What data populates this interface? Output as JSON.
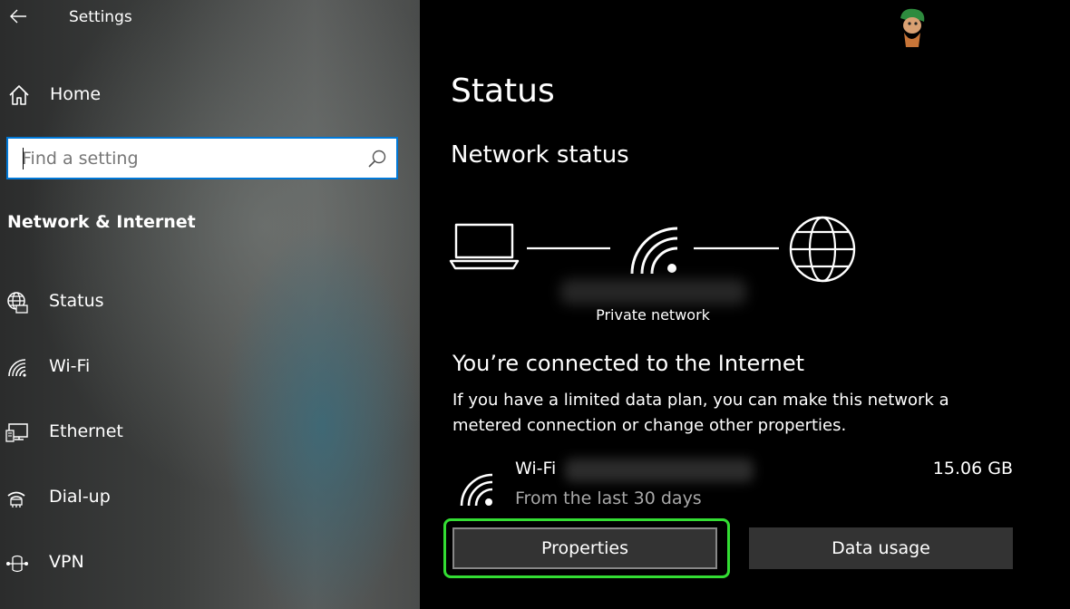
{
  "window": {
    "title": "Settings"
  },
  "sidebar": {
    "home_label": "Home",
    "search_placeholder": "Find a setting",
    "section_heading": "Network & Internet",
    "items": [
      {
        "label": "Status",
        "icon": "globe-status-icon"
      },
      {
        "label": "Wi-Fi",
        "icon": "wifi-icon"
      },
      {
        "label": "Ethernet",
        "icon": "ethernet-icon"
      },
      {
        "label": "Dial-up",
        "icon": "dial-up-icon"
      },
      {
        "label": "VPN",
        "icon": "vpn-icon"
      }
    ]
  },
  "main": {
    "title": "Status",
    "network_status_heading": "Network status",
    "network_type": "Private network",
    "connected_title": "You’re connected to the Internet",
    "connected_desc": "If you have a limited data plan, you can make this network a metered connection or change other properties.",
    "connection": {
      "name": "Wi-Fi",
      "period": "From the last 30 days",
      "usage": "15.06 GB"
    },
    "buttons": {
      "properties": "Properties",
      "data_usage": "Data usage"
    }
  },
  "colors": {
    "accent": "#0078d7",
    "highlight": "#33dd33",
    "button_bg": "#333333"
  }
}
